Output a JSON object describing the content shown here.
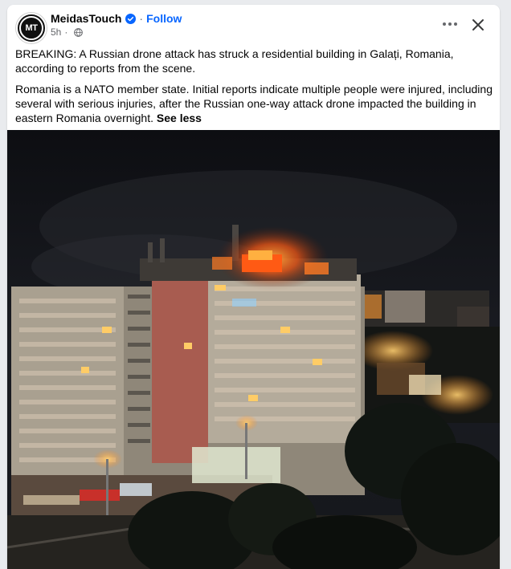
{
  "post": {
    "author": "MeidasTouch",
    "avatar_text": "MT",
    "verified_icon": "verified-badge-icon",
    "follow_label": "Follow",
    "separator": "·",
    "time": "5h",
    "audience_icon": "globe-icon",
    "more_icon": "more-dots-icon",
    "close_icon": "close-icon",
    "paragraph1": "BREAKING: A Russian drone attack has struck a residential building in Galați, Romania, according to reports from the scene.",
    "paragraph2": "Romania is a NATO member state. Initial reports indicate multiple people were injured, including several with serious injuries, after the Russian one-way attack drone impacted the building in eastern Romania overnight.",
    "see_less_label": "See less"
  },
  "colors": {
    "link": "#0866ff",
    "secondary_text": "#65676b",
    "fire": "#ff5a14",
    "building": "#d9c9b5"
  }
}
